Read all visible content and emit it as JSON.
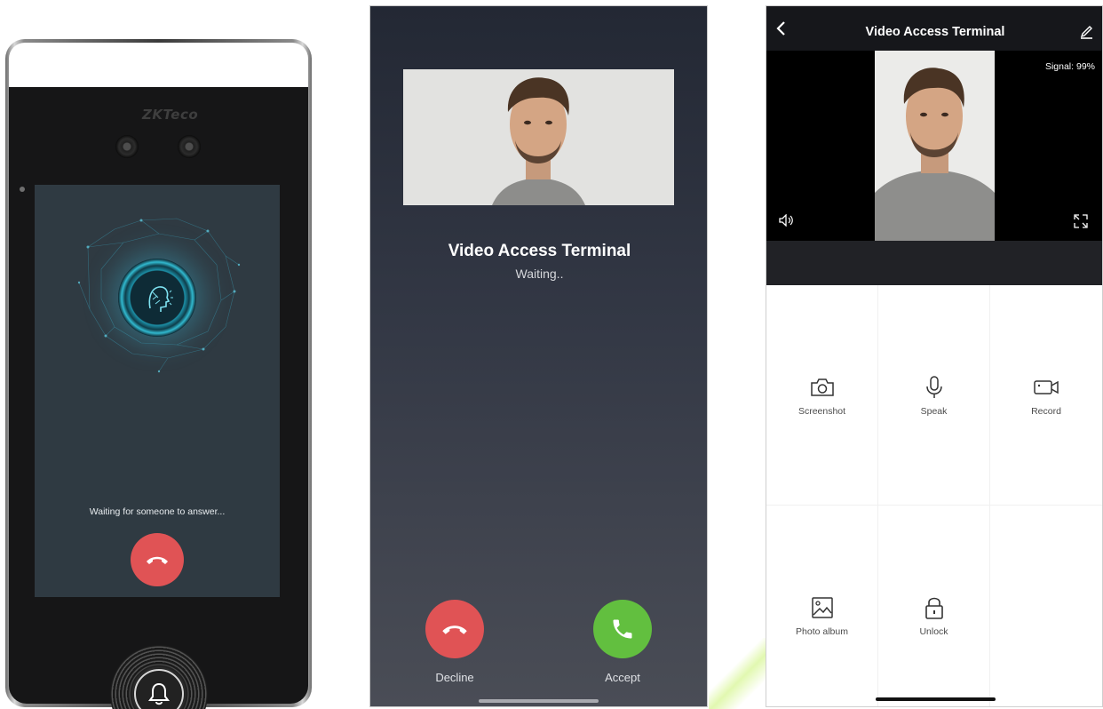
{
  "device": {
    "logo": "ZKTeco",
    "screen_status": "Waiting for someone to answer..."
  },
  "call": {
    "title": "Video Access Terminal",
    "status": "Waiting..",
    "decline_label": "Decline",
    "accept_label": "Accept"
  },
  "app": {
    "title": "Video Access Terminal",
    "signal": "Signal: 99%",
    "actions": [
      {
        "label": "Screenshot",
        "icon": "camera-icon"
      },
      {
        "label": "Speak",
        "icon": "microphone-icon"
      },
      {
        "label": "Record",
        "icon": "video-camera-icon"
      },
      {
        "label": "Photo album",
        "icon": "image-icon"
      },
      {
        "label": "Unlock",
        "icon": "lock-icon"
      }
    ]
  },
  "colors": {
    "decline": "#e05355",
    "accept": "#62bf3f",
    "header_dark": "#16171b"
  }
}
